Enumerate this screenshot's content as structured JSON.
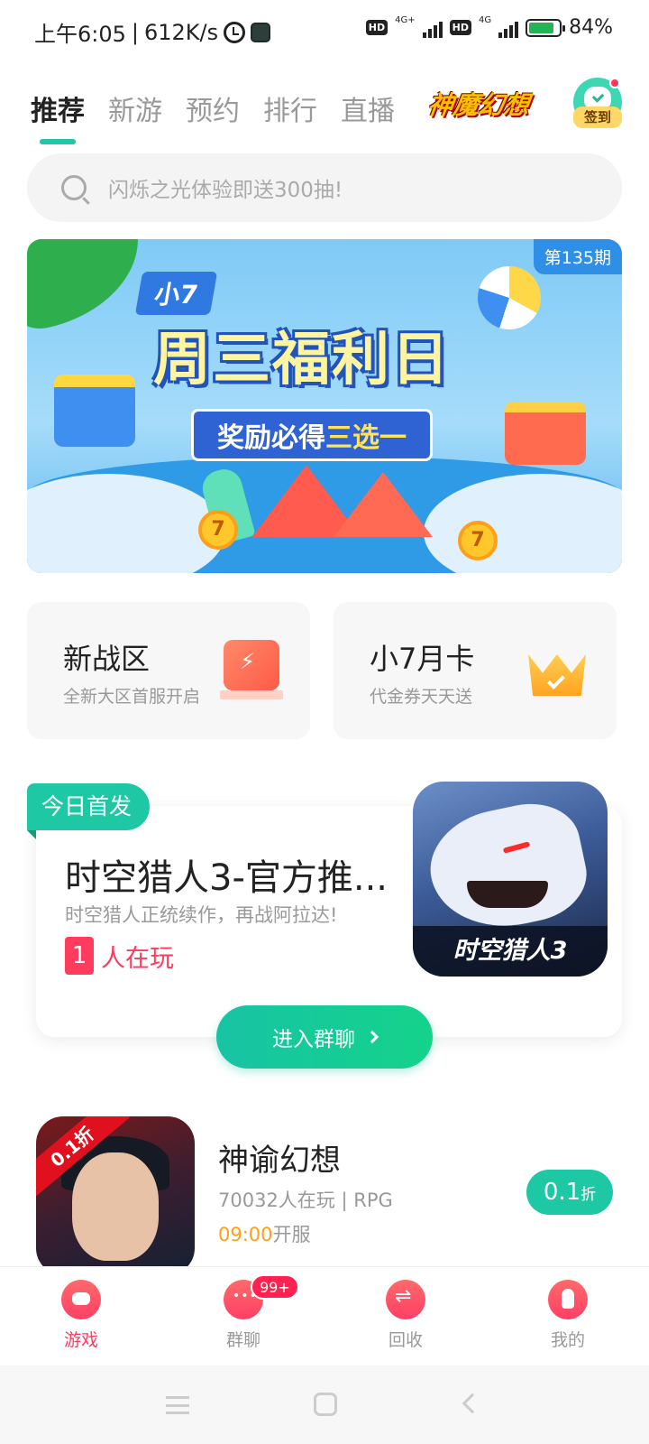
{
  "status_bar": {
    "time": "上午6:05",
    "separator": "|",
    "speed": "612K/s",
    "net_1": "4G+",
    "net_2": "4G",
    "battery": "84%"
  },
  "tabs": [
    {
      "label": "推荐",
      "active": true
    },
    {
      "label": "新游",
      "active": false
    },
    {
      "label": "预约",
      "active": false
    },
    {
      "label": "排行",
      "active": false
    },
    {
      "label": "直播",
      "active": false
    }
  ],
  "brand_tab": "神魔幻想",
  "checkin_label": "签到",
  "search": {
    "placeholder": "闪烁之光体验即送300抽!"
  },
  "banner": {
    "issue": "第135期",
    "brand": "小7",
    "headline": "周三福利日",
    "subline_1": "奖励必得",
    "subline_2": "三选一",
    "coin": "7"
  },
  "features": [
    {
      "title": "新战区",
      "subtitle": "全新大区首服开启",
      "icon": "lightning-flag-icon"
    },
    {
      "title": "小7月卡",
      "subtitle": "代金券天天送",
      "icon": "crown-icon"
    }
  ],
  "release": {
    "tag": "今日首发",
    "title": "时空猎人3-官方推...",
    "description": "时空猎人正统续作，再战阿拉达!",
    "players_count": "1",
    "players_label": "人在玩",
    "cover_logo": "时空猎人3",
    "enter_button": "进入群聊"
  },
  "game": {
    "ribbon": "0.1折",
    "title": "神谕幻想",
    "meta": "70032人在玩 | RPG",
    "open_time": "09:00",
    "open_label": "开服",
    "discount_value": "0.1",
    "discount_unit": "折"
  },
  "bottom_nav": [
    {
      "label": "游戏",
      "active": true,
      "icon": "gamepad-icon"
    },
    {
      "label": "群聊",
      "active": false,
      "icon": "chat-icon",
      "badge": "99+"
    },
    {
      "label": "回收",
      "active": false,
      "icon": "recycle-icon"
    },
    {
      "label": "我的",
      "active": false,
      "icon": "profile-icon"
    }
  ],
  "colors": {
    "accent": "#1fc8a4",
    "active_nav": "#ff3b5e",
    "open_time": "#ff9f1a"
  }
}
